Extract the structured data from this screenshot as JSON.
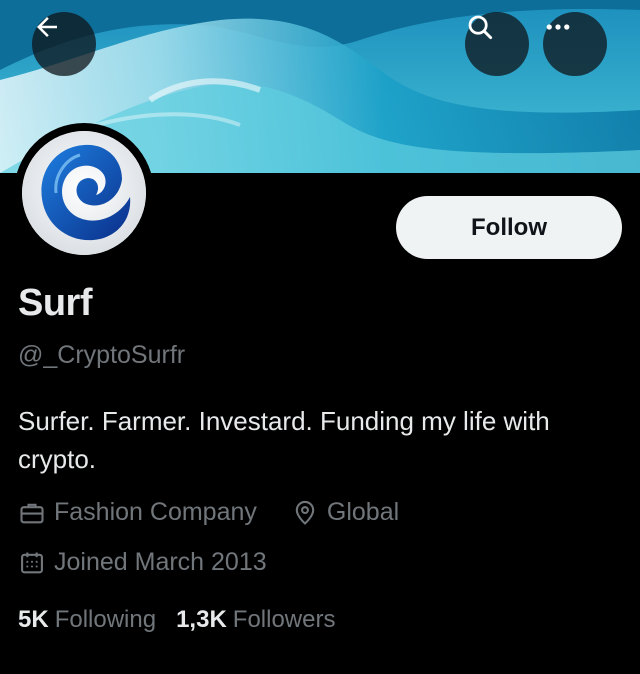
{
  "header": {
    "back_icon": "arrow-left-icon",
    "search_icon": "search-icon",
    "more_icon": "more-horizontal-icon"
  },
  "profile": {
    "name": "Surf",
    "handle": "@_CryptoSurfr",
    "bio": "Surfer. Farmer. Investard. Funding my life with crypto.",
    "follow_label": "Follow",
    "category": "Fashion Company",
    "location": "Global",
    "joined": "Joined March 2013",
    "following_count": "5K",
    "following_label": "Following",
    "followers_count": "1,3K",
    "followers_label": "Followers"
  },
  "colors": {
    "background": "#000000",
    "primary_text": "#e7e9ea",
    "secondary_text": "#71767b",
    "follow_button_bg": "#eff3f4"
  }
}
